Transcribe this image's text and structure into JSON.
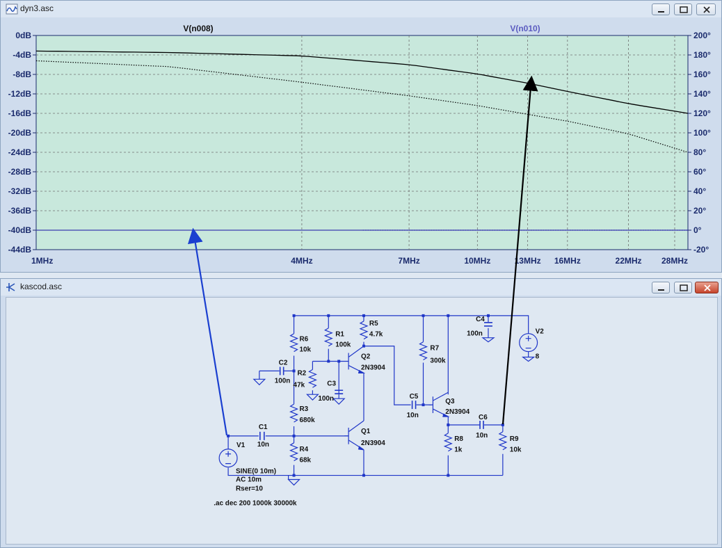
{
  "plot_window": {
    "title": "dyn3.asc",
    "trace1_label": "V(n008)",
    "trace2_label": "V(n010)",
    "left_ticks": [
      "0dB",
      "-4dB",
      "-8dB",
      "-12dB",
      "-16dB",
      "-20dB",
      "-24dB",
      "-28dB",
      "-32dB",
      "-36dB",
      "-40dB",
      "-44dB"
    ],
    "right_ticks": [
      "200°",
      "180°",
      "160°",
      "140°",
      "120°",
      "100°",
      "80°",
      "60°",
      "40°",
      "20°",
      "0°",
      "-20°"
    ],
    "x_ticks": [
      "1MHz",
      "4MHz",
      "7MHz",
      "10MHz",
      "13MHz",
      "16MHz",
      "22MHz",
      "28MHz"
    ],
    "colors": {
      "plot_bg": "#c8e8dc",
      "trace1": "#000000",
      "trace2": "#3b3bb0",
      "axis": "#1a2a6c"
    }
  },
  "chart_data": {
    "type": "line",
    "xscale": "log",
    "xlim_hz": [
      1000000,
      30000000
    ],
    "ylim_left_db": [
      -44,
      0
    ],
    "ylim_right_deg": [
      -20,
      200
    ],
    "grid": true,
    "series": [
      {
        "name": "V(n008)",
        "style": "solid",
        "axis": "left",
        "x_mhz": [
          1,
          2,
          4,
          7,
          10,
          13,
          16,
          22,
          30
        ],
        "y_db": [
          -3.2,
          -3.5,
          -4.2,
          -6.0,
          -7.9,
          -9.8,
          -11.5,
          -14.0,
          -16.0
        ]
      },
      {
        "name": "V(n008) phase",
        "style": "dotted",
        "axis": "right",
        "x_mhz": [
          1,
          2,
          4,
          7,
          10,
          13,
          16,
          22,
          30
        ],
        "y_deg": [
          174,
          168,
          152,
          138,
          128,
          119,
          112,
          99,
          80
        ]
      },
      {
        "name": "V(n010)",
        "style": "solid",
        "axis": "left",
        "x_mhz": [
          1,
          30
        ],
        "y_db": [
          -40,
          -40
        ]
      },
      {
        "name": "V(n010) phase",
        "style": "dotted",
        "axis": "right",
        "x_mhz": [
          5.5,
          30
        ],
        "y_deg": [
          0,
          0
        ]
      }
    ]
  },
  "schematic_window": {
    "title": "kascod.asc",
    "labels": {
      "R1": "R1",
      "R1v": "100k",
      "R2": "R2",
      "R2v": "47k",
      "R3": "R3",
      "R3v": "680k",
      "R4": "R4",
      "R4v": "68k",
      "R5": "R5",
      "R5v": "4.7k",
      "R6": "R6",
      "R6v": "10k",
      "R7": "R7",
      "R7v": "300k",
      "R8": "R8",
      "R8v": "1k",
      "R9": "R9",
      "R9v": "10k",
      "C1": "C1",
      "C1v": "10n",
      "C2": "C2",
      "C2v": "100n",
      "C3": "C3",
      "C3v": "100n",
      "C4": "C4",
      "C4v": "100n",
      "C5": "C5",
      "C5v": "10n",
      "C6": "C6",
      "C6v": "10n",
      "Q1": "Q1",
      "Q1m": "2N3904",
      "Q2": "Q2",
      "Q2m": "2N3904",
      "Q3": "Q3",
      "Q3m": "2N3904",
      "V1": "V1",
      "V1a": "SINE(0 10m)",
      "V1b": "AC 10m",
      "V1c": "Rser=10",
      "V2": "V2",
      "V2v": "8",
      "directive": ".ac dec 200 1000k 30000k"
    }
  }
}
